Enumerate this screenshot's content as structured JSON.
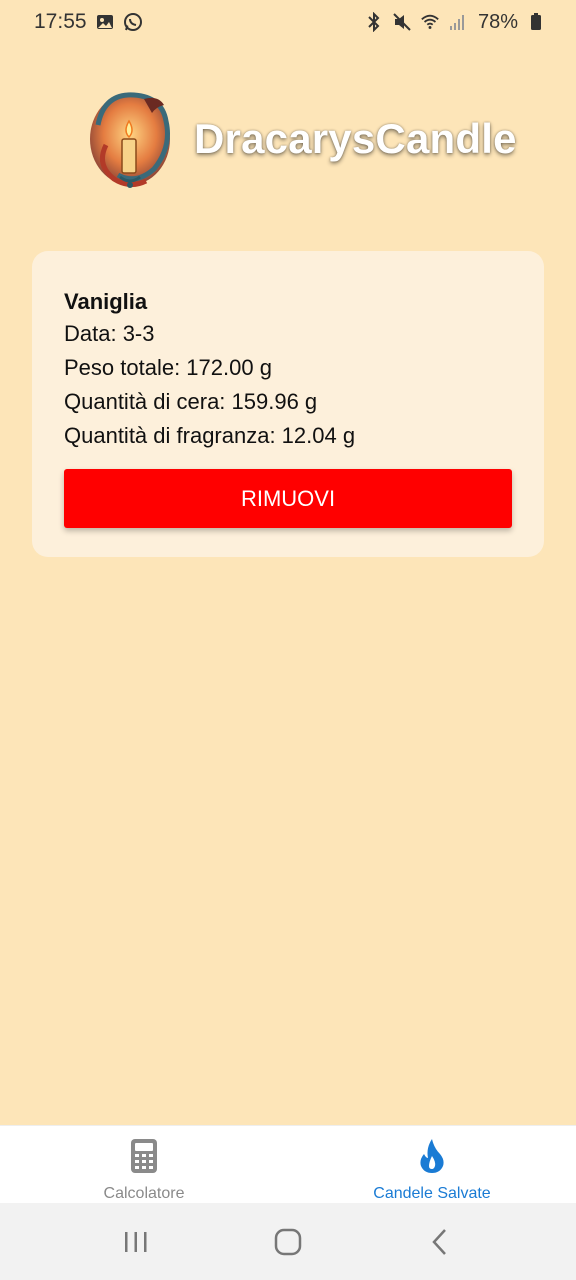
{
  "status_bar": {
    "time": "17:55",
    "battery": "78%",
    "left_icons": [
      "image-icon",
      "whatsapp-icon"
    ],
    "right_icons": [
      "bluetooth-icon",
      "mute-icon",
      "wifi-icon",
      "signal-icon",
      "battery-icon"
    ]
  },
  "header": {
    "app_title": "DracarysCandle",
    "logo_icon": "dragon-candle-logo"
  },
  "saved_candle": {
    "name": "Vaniglia",
    "date": "Data: 3-3",
    "total_weight": "Peso totale: 172.00 g",
    "wax_amount": "Quantità di cera: 159.96 g",
    "fragrance_amount": "Quantità di fragranza: 12.04 g",
    "remove_label": "RIMUOVI"
  },
  "tabs": [
    {
      "label": "Calcolatore",
      "icon": "calculator-icon",
      "active": false
    },
    {
      "label": "Candele Salvate",
      "icon": "flame-icon",
      "active": true
    }
  ],
  "colors": {
    "background": "#fde5b8",
    "card": "#fdf0db",
    "remove_button": "#ff0000",
    "active_tab": "#1a7bd4",
    "inactive_tab": "#8a8a8a"
  },
  "nav_bar": {
    "buttons": [
      "recents-icon",
      "home-icon",
      "back-icon"
    ]
  }
}
